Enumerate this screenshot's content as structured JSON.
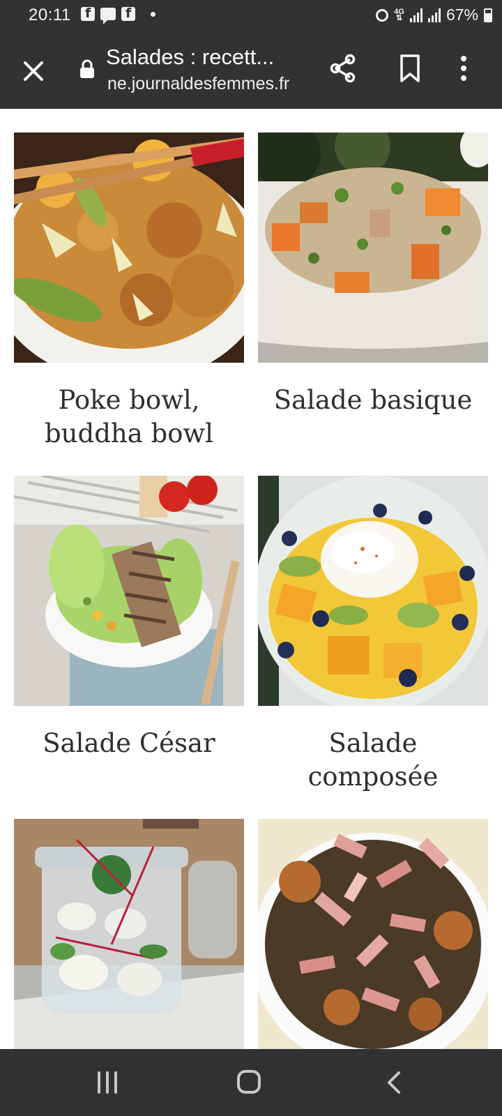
{
  "status_bar": {
    "time": "20:11",
    "battery": "67%",
    "network": "4G"
  },
  "toolbar": {
    "title": "Salades : recett...",
    "url": "ne.journaldesfemmes.fr"
  },
  "cards": [
    {
      "caption_line1": "Poke bowl,",
      "caption_line2": "buddha bowl"
    },
    {
      "caption_line1": "Salade basique",
      "caption_line2": ""
    },
    {
      "caption_line1": "Salade César",
      "caption_line2": ""
    },
    {
      "caption_line1": "Salade",
      "caption_line2": "composée"
    }
  ],
  "icons": {
    "close": "close-icon",
    "lock": "lock-icon",
    "share": "share-icon",
    "bookmark": "bookmark-icon",
    "more": "more-vert-icon",
    "recents": "recents-icon",
    "home": "home-icon",
    "back": "back-icon"
  },
  "colors": {
    "bar_background": "#313234",
    "caption_text": "#2e2e2e"
  }
}
